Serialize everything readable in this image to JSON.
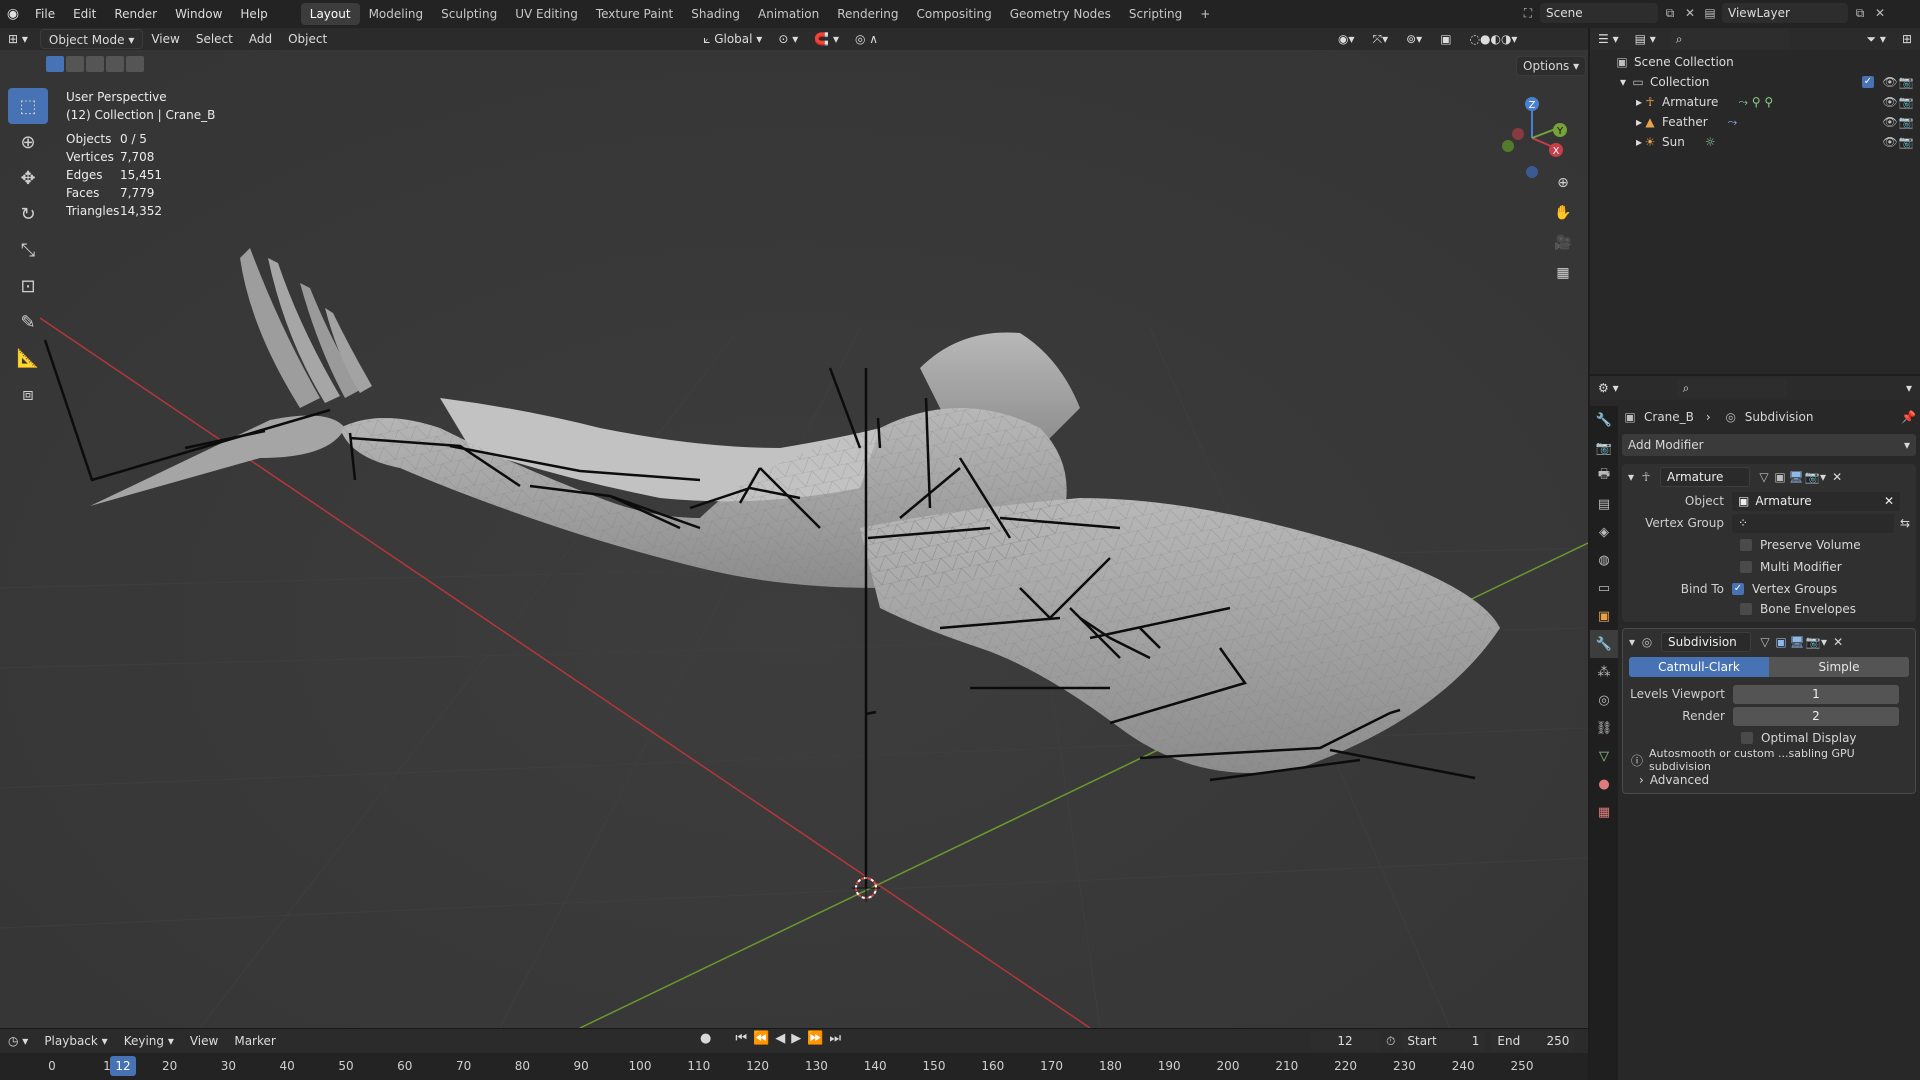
{
  "topbar": {
    "menus": [
      "File",
      "Edit",
      "Render",
      "Window",
      "Help"
    ],
    "workspaces": [
      "Layout",
      "Modeling",
      "Sculpting",
      "UV Editing",
      "Texture Paint",
      "Shading",
      "Animation",
      "Rendering",
      "Compositing",
      "Geometry Nodes",
      "Scripting"
    ],
    "active_workspace": "Layout",
    "add_tab": "+",
    "scene": "Scene",
    "view_layer": "ViewLayer"
  },
  "viewport": {
    "mode": "Object Mode",
    "menus": [
      "View",
      "Select",
      "Add",
      "Object"
    ],
    "orientation": "Global",
    "options_label": "Options",
    "perspective": "User Perspective",
    "collection_info": "(12) Collection | Crane_B",
    "stats": [
      {
        "label": "Objects",
        "value": "0 / 5"
      },
      {
        "label": "Vertices",
        "value": "7,708"
      },
      {
        "label": "Edges",
        "value": "15,451"
      },
      {
        "label": "Faces",
        "value": "7,779"
      },
      {
        "label": "Triangles",
        "value": "14,352"
      }
    ],
    "gizmo_axes": {
      "z": "Z",
      "y": "Y",
      "x": "X"
    },
    "colors": {
      "x_axis": "#b5363a",
      "y_axis": "#6a9a2e",
      "bg": "#393939",
      "accent": "#4772b3"
    }
  },
  "timeline": {
    "menus": [
      "Playback",
      "Keying",
      "View",
      "Marker"
    ],
    "current_frame": "12",
    "start_label": "Start",
    "start": "1",
    "end_label": "End",
    "end": "250",
    "ticks": [
      "0",
      "10",
      "20",
      "30",
      "40",
      "50",
      "60",
      "70",
      "80",
      "90",
      "100",
      "110",
      "120",
      "130",
      "140",
      "150",
      "160",
      "170",
      "180",
      "190",
      "200",
      "210",
      "220",
      "230",
      "240",
      "250"
    ]
  },
  "outliner": {
    "scene_collection": "Scene Collection",
    "collection": "Collection",
    "items": [
      "Armature",
      "Feather",
      "Sun"
    ]
  },
  "properties": {
    "breadcrumb_object": "Crane_B",
    "breadcrumb_modifier": "Subdivision",
    "add_modifier": "Add Modifier",
    "armature": {
      "name": "Armature",
      "object_label": "Object",
      "object_value": "Armature",
      "vertex_group_label": "Vertex Group",
      "preserve_volume": "Preserve Volume",
      "multi_modifier": "Multi Modifier",
      "bind_to_label": "Bind To",
      "vertex_groups": "Vertex Groups",
      "bone_envelopes": "Bone Envelopes"
    },
    "subdivision": {
      "name": "Subdivision",
      "catmull": "Catmull-Clark",
      "simple": "Simple",
      "levels_viewport_label": "Levels Viewport",
      "levels_viewport": "1",
      "render_label": "Render",
      "render": "2",
      "optimal_display": "Optimal Display",
      "warning": "Autosmooth or custom ...sabling GPU subdivision",
      "advanced": "Advanced"
    }
  }
}
